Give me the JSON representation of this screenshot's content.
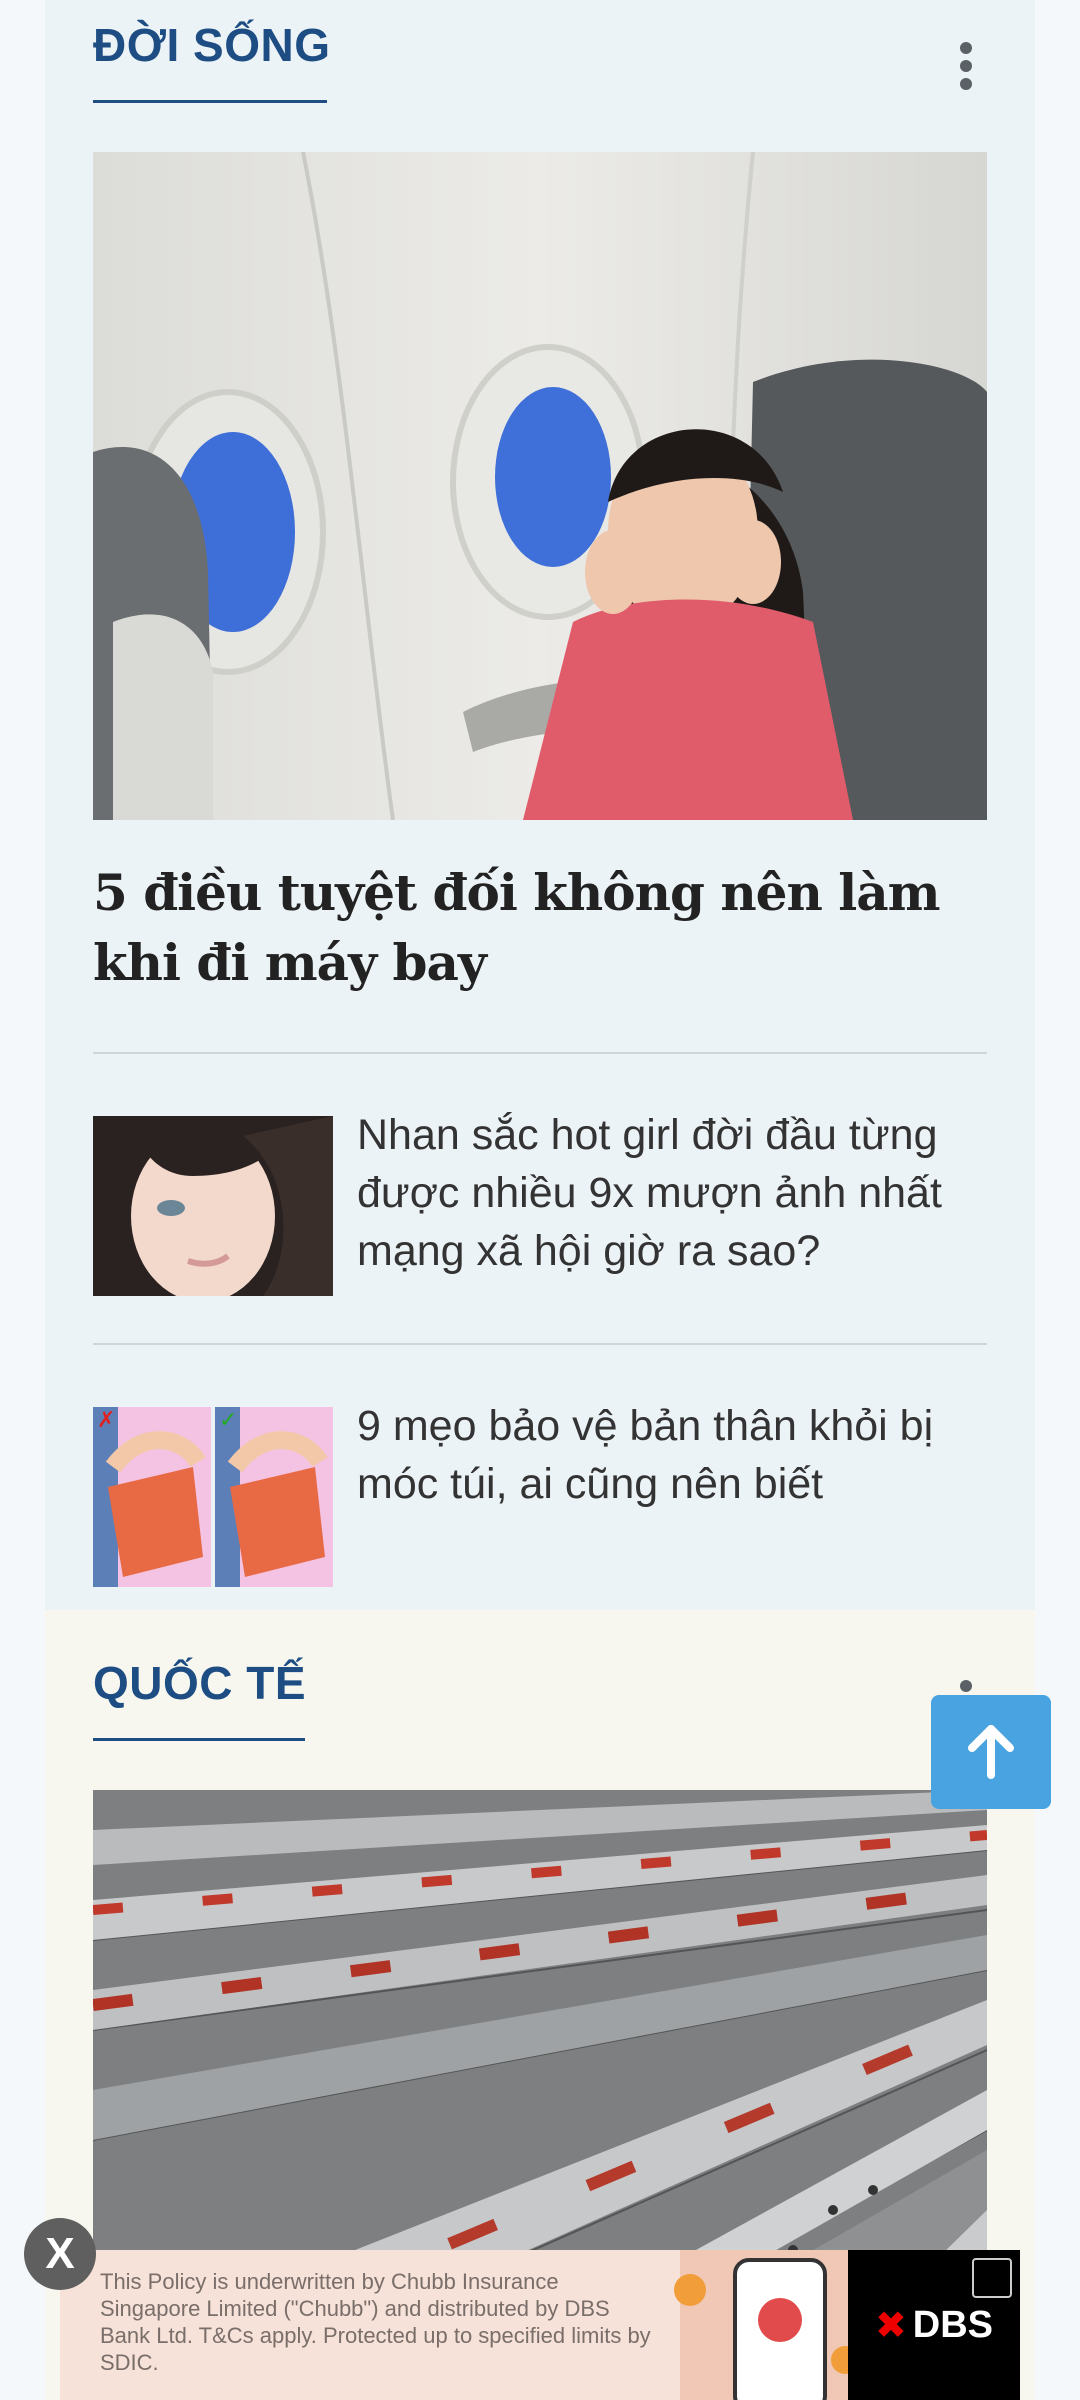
{
  "sections": {
    "life": {
      "title": "ĐỜI SỐNG",
      "main_headline": "5 điều tuyệt đối không nên làm khi đi máy bay",
      "items": [
        {
          "text": "Nhan sắc hot girl đời đầu từng được nhiều 9x mượn ảnh nhất mạng xã hội giờ ra sao?"
        },
        {
          "text": "9 mẹo bảo vệ bản thân khỏi bị móc túi, ai cũng nên biết"
        }
      ]
    },
    "world": {
      "title": "QUỐC TẾ"
    }
  },
  "ad": {
    "close_label": "X",
    "text": "This Policy is underwritten by Chubb Insurance Singapore Limited (\"Chubb\") and distributed by DBS Bank Ltd. T&Cs apply. Protected up to specified limits by SDIC.",
    "brand": "DBS",
    "brand_mark": "✖"
  },
  "icons": {
    "kebab": "more-vertical-icon",
    "back_to_top": "arrow-up-icon"
  },
  "colors": {
    "accent": "#1d4d83",
    "back_to_top": "#48a3e0"
  }
}
